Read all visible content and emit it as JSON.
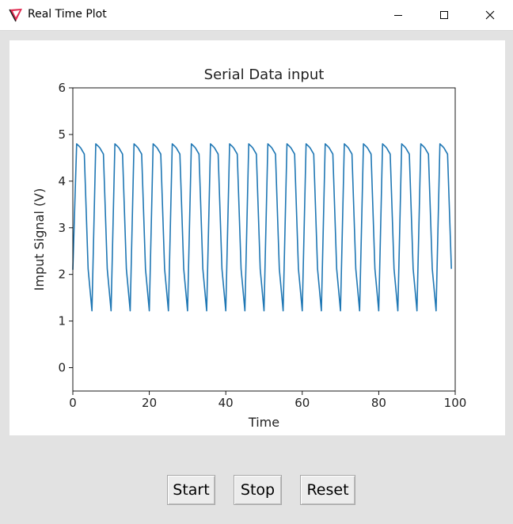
{
  "window": {
    "title": "Real Time Plot"
  },
  "buttons": {
    "start": "Start",
    "stop": "Stop",
    "reset": "Reset"
  },
  "colors": {
    "line": "#1f77b4"
  },
  "chart_data": {
    "type": "line",
    "title": "Serial Data input",
    "xlabel": "Time",
    "ylabel": "Imput Signal (V)",
    "xlim": [
      0,
      100
    ],
    "ylim": [
      -0.5,
      6
    ],
    "xticks": [
      0,
      20,
      40,
      60,
      80,
      100
    ],
    "yticks": [
      0,
      1,
      2,
      3,
      4,
      5,
      6
    ],
    "grid": false,
    "series": [
      {
        "x": [
          0,
          1,
          2,
          3,
          4,
          5,
          6,
          7,
          8,
          9,
          10,
          11,
          12,
          13,
          14,
          15,
          16,
          17,
          18,
          19,
          20,
          21,
          22,
          23,
          24,
          25,
          26,
          27,
          28,
          29,
          30,
          31,
          32,
          33,
          34,
          35,
          36,
          37,
          38,
          39,
          40,
          41,
          42,
          43,
          44,
          45,
          46,
          47,
          48,
          49,
          50,
          51,
          52,
          53,
          54,
          55,
          56,
          57,
          58,
          59,
          60,
          61,
          62,
          63,
          64,
          65,
          66,
          67,
          68,
          69,
          70,
          71,
          72,
          73,
          74,
          75,
          76,
          77,
          78,
          79,
          80,
          81,
          82,
          83,
          84,
          85,
          86,
          87,
          88,
          89,
          90,
          91,
          92,
          93,
          94,
          95,
          96,
          97,
          98,
          99
        ],
        "y": [
          2.1,
          4.8,
          4.72,
          4.58,
          2.12,
          1.22,
          4.8,
          4.72,
          4.58,
          2.12,
          1.22,
          4.8,
          4.72,
          4.58,
          2.12,
          1.22,
          4.8,
          4.72,
          4.58,
          2.12,
          1.22,
          4.8,
          4.72,
          4.58,
          2.12,
          1.22,
          4.8,
          4.72,
          4.58,
          2.12,
          1.22,
          4.8,
          4.72,
          4.58,
          2.12,
          1.22,
          4.8,
          4.72,
          4.58,
          2.12,
          1.22,
          4.8,
          4.72,
          4.58,
          2.12,
          1.22,
          4.8,
          4.72,
          4.58,
          2.12,
          1.22,
          4.8,
          4.72,
          4.58,
          2.12,
          1.22,
          4.8,
          4.72,
          4.58,
          2.12,
          1.22,
          4.8,
          4.72,
          4.58,
          2.12,
          1.22,
          4.8,
          4.72,
          4.58,
          2.12,
          1.22,
          4.8,
          4.72,
          4.58,
          2.12,
          1.22,
          4.8,
          4.72,
          4.58,
          2.12,
          1.22,
          4.8,
          4.72,
          4.58,
          2.12,
          1.22,
          4.8,
          4.72,
          4.58,
          2.12,
          1.22,
          4.8,
          4.72,
          4.58,
          2.12,
          1.22,
          4.8,
          4.72,
          4.58,
          2.12
        ]
      }
    ]
  }
}
